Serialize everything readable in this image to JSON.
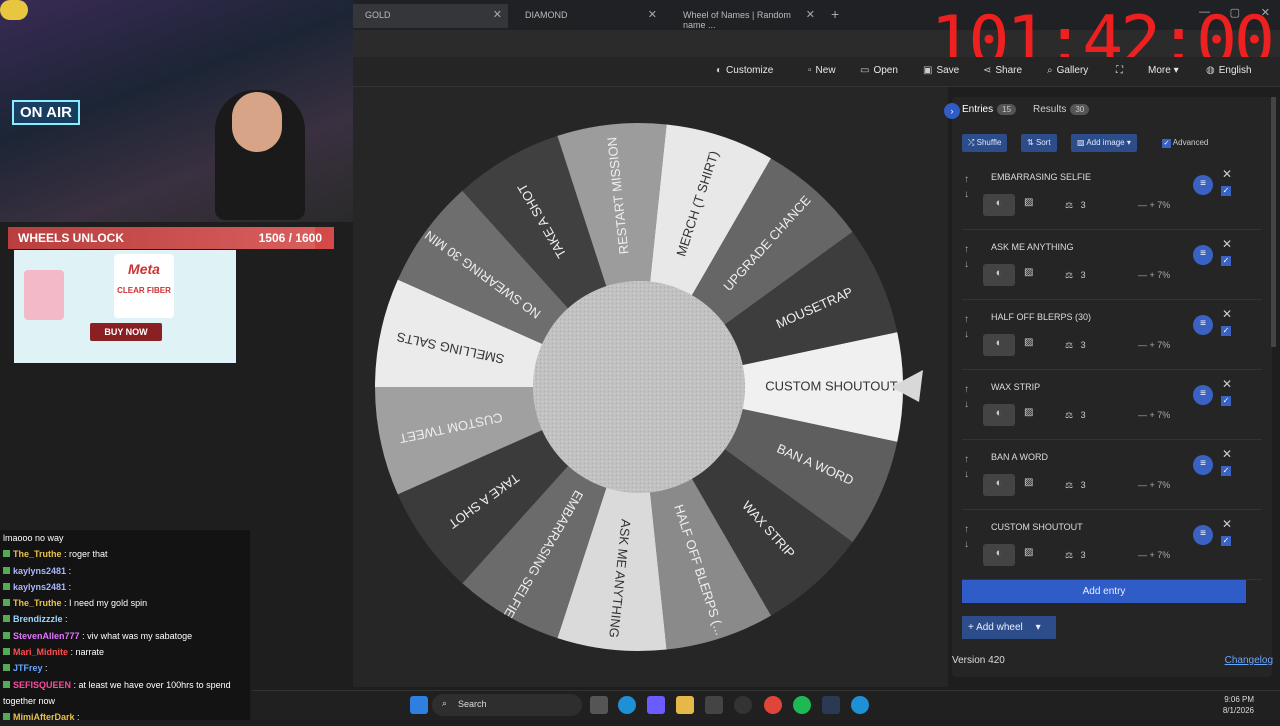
{
  "browser": {
    "tabs": [
      {
        "label": "GOLD"
      },
      {
        "label": "DIAMOND"
      },
      {
        "label": "Wheel of Names | Random name ..."
      }
    ]
  },
  "timer": "101:42:00",
  "toolbar": {
    "customize": "Customize",
    "new": "New",
    "open": "Open",
    "save": "Save",
    "share": "Share",
    "gallery": "Gallery",
    "more": "More",
    "language": "English"
  },
  "wheel": {
    "segments": [
      "CUSTOM SHOUTOUT",
      "BAN A WORD",
      "WAX STRIP",
      "HALF OFF BLERPS (...",
      "ASK ME ANYTHING",
      "EMBARRASING SELFIE",
      "TAKE A SHOT",
      "CUSTOM TWEET",
      "SMELLING SALTS",
      "NO SWEARING 30 MIN",
      "TAKE A SHOT",
      "RESTART MISSION",
      "MERCH (T SHIRT)",
      "UPGRADE CHANCE",
      "MOUSETRAP"
    ],
    "colors": [
      "#f0f0f0",
      "#5e5e5e",
      "#3a3a3a",
      "#8a8a8a",
      "#dadada",
      "#6b6b6b",
      "#3b3b3b",
      "#a0a0a0",
      "#ebebeb",
      "#6e6e6e",
      "#404040",
      "#9c9c9c",
      "#e8e8e8",
      "#666666",
      "#3d3d3d"
    ]
  },
  "overlay": {
    "unlock_label": "WHEELS UNLOCK",
    "unlock_count": "1506 / 1600",
    "unlock_progress": 0.941,
    "onair": "ON AIR",
    "ad_cta": "BUY NOW",
    "ad_brand": "Meta",
    "ad_product": "CLEAR FIBER"
  },
  "chat": [
    {
      "user": "",
      "color": "#ffffff",
      "text": "lmaooo no way"
    },
    {
      "user": "The_Truthe",
      "color": "#e8c24a",
      "text": ": roger that"
    },
    {
      "user": "kaylyns2481",
      "color": "#a9b8ff",
      "text": ":"
    },
    {
      "user": "kaylyns2481",
      "color": "#a9b8ff",
      "text": ":"
    },
    {
      "user": "The_Truthe",
      "color": "#e8c24a",
      "text": ": I need my gold spin"
    },
    {
      "user": "Brendizzzle",
      "color": "#9ad8ff",
      "text": ":"
    },
    {
      "user": "StevenAllen777",
      "color": "#e075ff",
      "text": ": viv what was my sabatoge"
    },
    {
      "user": "Mari_Midnite",
      "color": "#ff4d4d",
      "text": ": narrate"
    },
    {
      "user": "JTFrey",
      "color": "#6aa6ff",
      "text": ":"
    },
    {
      "user": "SEFISQUEEN",
      "color": "#ff4aa0",
      "text": ": at least we have over 100hrs to spend together now"
    },
    {
      "user": "MimiAfterDark",
      "color": "#e8c24a",
      "text": ":"
    }
  ],
  "sidebar": {
    "tab_entries": "Entries",
    "entries_count": "15",
    "tab_results": "Results",
    "results_count": "30",
    "shuffle": "Shuffle",
    "sort": "Sort",
    "add_image": "Add image",
    "advanced": "Advanced",
    "entries": [
      {
        "name": "EMBARRASING SELFIE",
        "weight": "3",
        "pct": "7%"
      },
      {
        "name": "ASK ME ANYTHING",
        "weight": "3",
        "pct": "7%"
      },
      {
        "name": "HALF OFF BLERPS (30)",
        "weight": "3",
        "pct": "7%"
      },
      {
        "name": "WAX STRIP",
        "weight": "3",
        "pct": "7%"
      },
      {
        "name": "BAN A WORD",
        "weight": "3",
        "pct": "7%"
      },
      {
        "name": "CUSTOM SHOUTOUT",
        "weight": "3",
        "pct": "7%"
      }
    ],
    "add_entry": "Add entry",
    "add_wheel": "Add wheel",
    "version": "Version 420",
    "changelog": "Changelog"
  },
  "taskbar": {
    "search": "Search",
    "time": "9:06 PM",
    "date": "8/1/2026"
  }
}
